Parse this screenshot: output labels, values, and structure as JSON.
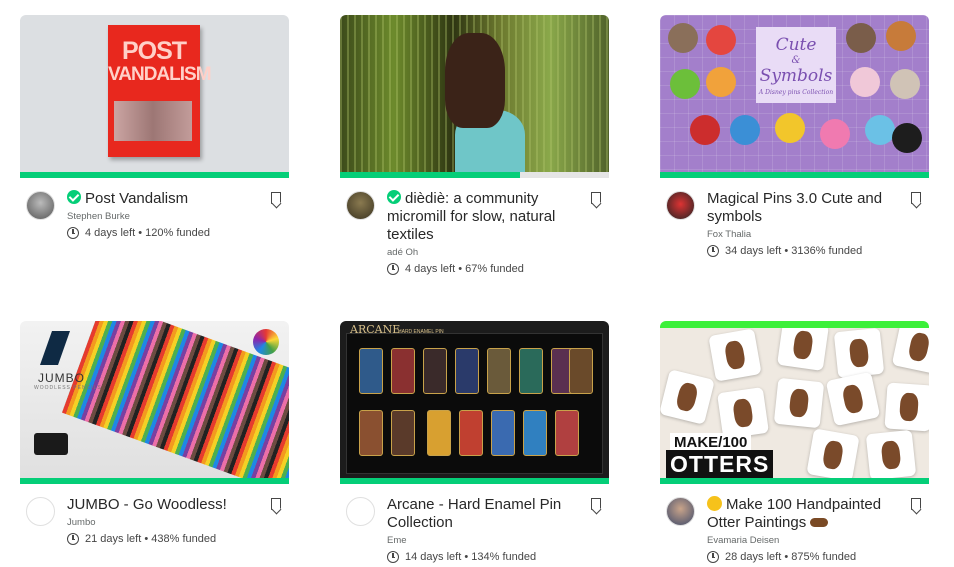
{
  "colors": {
    "accent": "#05ce78",
    "text": "#282828",
    "muted": "#656969"
  },
  "projects": [
    {
      "title": "Post Vandalism",
      "verified": true,
      "creator": "Stephen Burke",
      "days_left": "4 days left",
      "separator": "•",
      "funded": "120% funded",
      "progress": 1.0,
      "image_text": {
        "line1": "POST",
        "line2": "VANDALISM"
      }
    },
    {
      "title": "dièdiè: a community micromill for slow, natural textiles",
      "verified": true,
      "creator": "adé Oh",
      "days_left": "4 days left",
      "separator": "•",
      "funded": "67% funded",
      "progress": 0.67
    },
    {
      "title": "Magical Pins 3.0 Cute and symbols",
      "verified": false,
      "creator": "Fox Thalia",
      "days_left": "34 days left",
      "separator": "•",
      "funded": "3136% funded",
      "progress": 1.0,
      "image_text": {
        "line1": "Cute",
        "line2": "&",
        "line3": "Symbols",
        "line4": "A Disney pins Collection"
      }
    },
    {
      "title": "JUMBO - Go Woodless!",
      "verified": false,
      "creator": "Jumbo",
      "days_left": "21 days left",
      "separator": "•",
      "funded": "438% funded",
      "progress": 1.0,
      "image_text": {
        "brand": "JUMBO",
        "sub": "WOODLESS PENCILS"
      }
    },
    {
      "title": "Arcane - Hard Enamel Pin Collection",
      "verified": false,
      "creator": "Eme",
      "days_left": "14 days left",
      "separator": "•",
      "funded": "134% funded",
      "progress": 1.0,
      "image_text": {
        "logo": "ARCANE",
        "sub": "HARD ENAMEL PIN"
      }
    },
    {
      "title": "Make 100 Handpainted Otter Paintings",
      "prefix_icon": "sun-emoji",
      "suffix_icon": "otter-emoji",
      "verified": false,
      "creator": "Evamaria Deisen",
      "days_left": "28 days left",
      "separator": "•",
      "funded": "875% funded",
      "progress": 1.0,
      "image_text": {
        "line1": "MAKE/100",
        "line2": "OTTERS"
      }
    }
  ]
}
